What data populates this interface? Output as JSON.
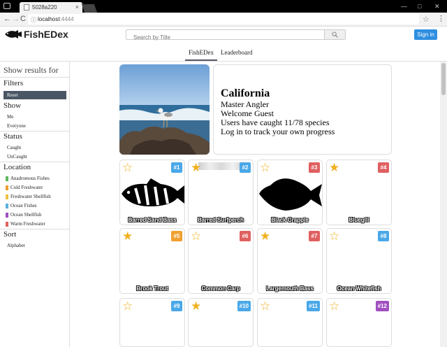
{
  "browser": {
    "tab_title": "5028a220",
    "tab_close": "×",
    "url_host": "localhost",
    "url_port": ":4444",
    "back": "←",
    "forward": "→",
    "reload": "C",
    "bookmark": "☆",
    "menu": "⋮",
    "win_min": "—",
    "win_max": "□",
    "win_close": "✕"
  },
  "header": {
    "logo": "FishEDex",
    "search_placeholder": "Search by Title",
    "signin": "Sign in"
  },
  "subnav": {
    "tabs": [
      "FishEDex",
      "Leaderboard"
    ],
    "active": "FishEDex"
  },
  "sidebar": {
    "title": "Show results for",
    "filters": "Filters",
    "reset": "Reset",
    "show": "Show",
    "show_items": [
      "Me",
      "Everyone"
    ],
    "status": "Status",
    "status_items": [
      "Caught",
      "UnCaught"
    ],
    "location": "Location",
    "locations": [
      {
        "label": "Anadromous Fishes",
        "color": "#5cb85c"
      },
      {
        "label": "Cold Freshwater",
        "color": "#f0a030"
      },
      {
        "label": "Freshwater Shellfish",
        "color": "#f0c040"
      },
      {
        "label": "Ocean Fishes",
        "color": "#5ab0e0"
      },
      {
        "label": "Ocean Shellfish",
        "color": "#a050c0"
      },
      {
        "label": "Warm Freshwater",
        "color": "#e06060"
      }
    ],
    "sort": "Sort",
    "sort_items": [
      "Alphabet"
    ]
  },
  "hero": {
    "title": "California",
    "lines": [
      "Master Angler",
      "Welcome Guest",
      "Users have caught 11/78 species",
      "Log in to track your own progress"
    ]
  },
  "cards": [
    {
      "num": "#1",
      "name": "Barred Sand Bass",
      "color": "#4aa8e8",
      "caught": false,
      "fish": "bass"
    },
    {
      "num": "#2",
      "name": "Barred Surfperch",
      "color": "#4aa8e8",
      "caught": true,
      "fish": "strip"
    },
    {
      "num": "#3",
      "name": "Black Crappie",
      "color": "#e06060",
      "caught": false,
      "fish": "crappie"
    },
    {
      "num": "#4",
      "name": "Bluegill",
      "color": "#e06060",
      "caught": true,
      "fish": ""
    },
    {
      "num": "#5",
      "name": "Brook Trout",
      "color": "#f0a030",
      "caught": true,
      "fish": ""
    },
    {
      "num": "#6",
      "name": "Common Carp",
      "color": "#e06060",
      "caught": false,
      "fish": ""
    },
    {
      "num": "#7",
      "name": "Largemouth Bass",
      "color": "#e06060",
      "caught": true,
      "fish": ""
    },
    {
      "num": "#8",
      "name": "Ocean Whitefish",
      "color": "#4aa8e8",
      "caught": false,
      "fish": ""
    },
    {
      "num": "#9",
      "name": "",
      "color": "#4aa8e8",
      "caught": false,
      "fish": ""
    },
    {
      "num": "#10",
      "name": "",
      "color": "#4aa8e8",
      "caught": true,
      "fish": ""
    },
    {
      "num": "#11",
      "name": "",
      "color": "#4aa8e8",
      "caught": false,
      "fish": ""
    },
    {
      "num": "#12",
      "name": "",
      "color": "#a050c0",
      "caught": false,
      "fish": ""
    }
  ]
}
